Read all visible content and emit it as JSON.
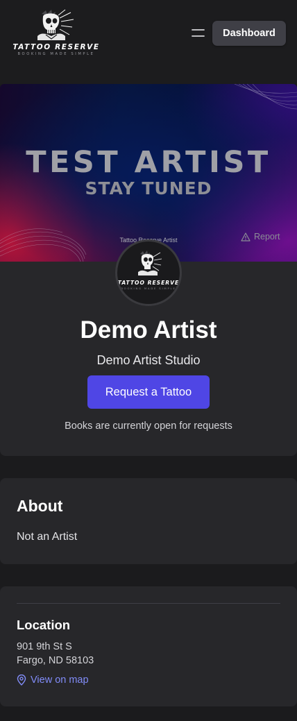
{
  "header": {
    "logo": {
      "wordmark": "TATTOO RESERVE",
      "tagline": "BOOKING MADE SIMPLE"
    },
    "menu_icon": "hamburger-menu-icon",
    "dashboard_label": "Dashboard"
  },
  "banner": {
    "title": "TEST ARTIST",
    "subtitle": "STAY TUNED",
    "caption": "Tattoo Reserve Artist",
    "report_label": "Report",
    "report_icon": "warning-triangle-icon"
  },
  "profile": {
    "avatar_wordmark": "TATTOO RESERVE",
    "avatar_tagline": "BOOKING MADE SIMPLE",
    "name": "Demo Artist",
    "studio": "Demo Artist Studio",
    "request_label": "Request a Tattoo",
    "status": "Books are currently open for requests"
  },
  "about": {
    "title": "About",
    "text": "Not an Artist"
  },
  "location": {
    "title": "Location",
    "address_line1": "901 9th St S",
    "address_line2": "Fargo, ND 58103",
    "map_label": "View on map",
    "map_icon": "map-pin-icon"
  },
  "colors": {
    "background": "#1b1b1d",
    "card": "#27272a",
    "accent": "#4f46e5",
    "link": "#818cf8",
    "dashboard_button": "#3f3f46"
  }
}
